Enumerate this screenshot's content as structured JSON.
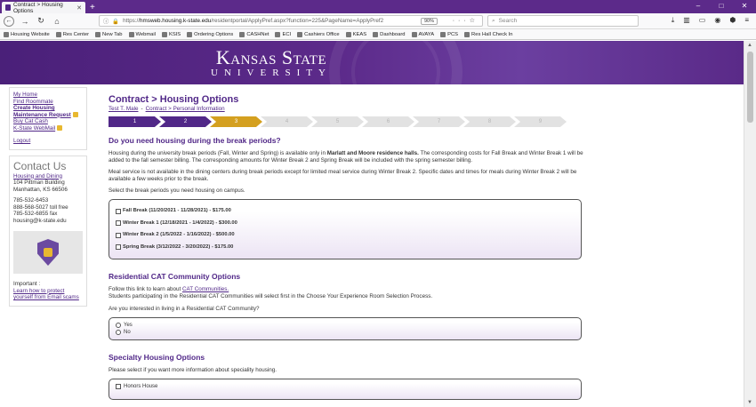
{
  "browser": {
    "tab_title": "Contract > Housing Options",
    "url_prefix": "https://",
    "url_host": "hmsweb.housing.k-state.edu",
    "url_path": "/residentportal/ApplyPref.aspx?function=225&PageName=ApplyPref2",
    "zoom": "90%",
    "search_placeholder": "Search",
    "bookmarks": [
      "Housing Website",
      "Res Center",
      "New Tab",
      "Webmail",
      "KSIS",
      "Ordering Options",
      "CASHNet",
      "ECI",
      "Cashiers Office",
      "KEAS",
      "Dashboard",
      "AVAYA",
      "PCS",
      "Res Hall Check In"
    ]
  },
  "banner": {
    "logo_line1": "Kansas State",
    "logo_line2": "UNIVERSITY"
  },
  "sidebar": {
    "links": [
      "My Home",
      "Find Roommate",
      "Create Housing Maintenance Request",
      "Buy Cat Cash",
      "K-State WebMail",
      "Logout"
    ],
    "contact_title": "Contact Us",
    "contact_link": "Housing and Dining",
    "contact_lines": [
      "104 Pittman Building",
      "Manhattan, KS 66506",
      "",
      "785-532-6453",
      "888-568-5027 toll free",
      "785-532-6855 fax",
      "housing@k-state.edu"
    ],
    "important_label": "Important :",
    "important_link": "Learn how to protect yourself from Email scams"
  },
  "main": {
    "title": "Contract > Housing Options",
    "crumb1": "Test T. Male",
    "crumb_sep": "-",
    "crumb2": "Contract > Personal Information",
    "steps": [
      "1",
      "2",
      "3",
      "4",
      "5",
      "6",
      "7",
      "8",
      "9"
    ],
    "current_step": 3,
    "break": {
      "heading": "Do you need housing during the break periods?",
      "p1_a": "Housing during the university break periods (Fall, Winter and Spring) is available only in ",
      "p1_b": "Marlatt and Moore residence halls.",
      "p1_c": " The corresponding costs for Fall Break and Winter Break 1 will be added to the fall semester billing. The corresponding amounts for Winter Break 2 and Spring Break will be included with the spring semester billing.",
      "p2": "Meal service is not available in the dining centers during break periods except for limited meal service during Winter Break 2. Specific dates and times for meals during Winter Break 2 will be available a few weeks prior to the break.",
      "p3": "Select the break periods you need housing on campus.",
      "options": [
        "Fall Break (11/20/2021 - 11/28/2021) - $175.00",
        "Winter Break 1 (12/18/2021 - 1/4/2022) - $300.00",
        "Winter Break 2 (1/5/2022 - 1/16/2022) - $500.00",
        "Spring Break (3/12/2022 - 3/20/2022) - $175.00"
      ]
    },
    "cat": {
      "heading": "Residential CAT Community Options",
      "p1_a": "Follow this link to learn about ",
      "p1_link": "CAT Communities.",
      "p1_b": "Students participating in the Residential CAT Communities will select first in the Choose Your Experience Room Selection Process.",
      "question": "Are you interested in living in a Residential CAT Community?",
      "yes": "Yes",
      "no": "No"
    },
    "specialty": {
      "heading": "Specialty Housing Options",
      "p1": "Please select if you want more information about speciality housing.",
      "option": "Honors House"
    }
  }
}
